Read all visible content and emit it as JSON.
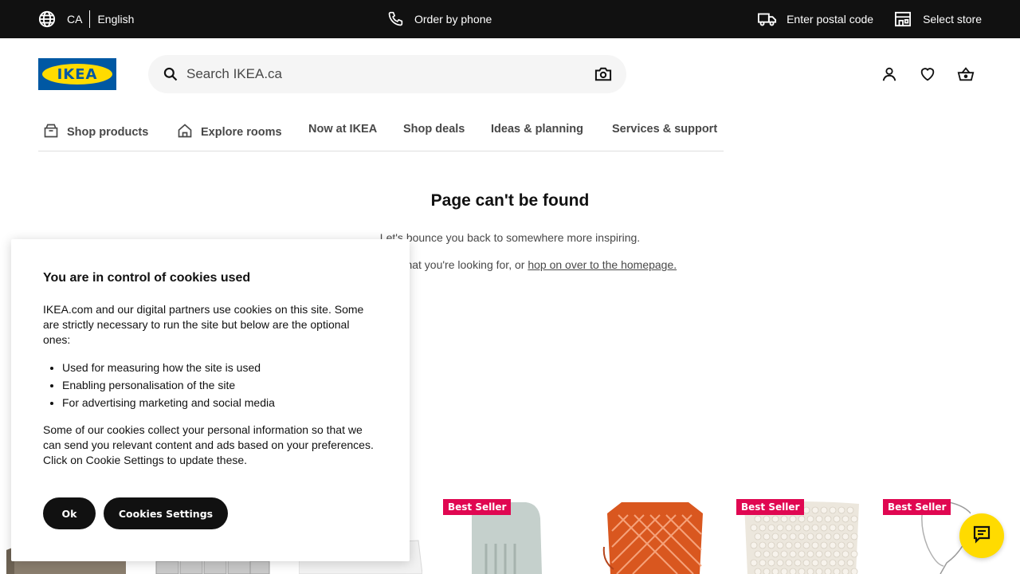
{
  "topbar": {
    "country": "CA",
    "language": "English",
    "order_by_phone": "Order by phone",
    "postal_code": "Enter postal code",
    "select_store": "Select store"
  },
  "header": {
    "logo_text": "IKEA",
    "search_placeholder": "Search IKEA.ca"
  },
  "nav": {
    "items": [
      {
        "label": "Shop products",
        "icon": "box-icon"
      },
      {
        "label": "Explore rooms",
        "icon": "house-icon"
      },
      {
        "label": "Now at IKEA"
      },
      {
        "label": "Shop deals"
      },
      {
        "label": "Ideas & planning"
      },
      {
        "label": "Services & support"
      }
    ]
  },
  "main": {
    "title": "Page can't be found",
    "line1": "Let's bounce you back to somewhere more inspiring.",
    "line2_prefix": "Search for what you're looking for, or ",
    "line2_link": "hop on over to the homepage."
  },
  "products": {
    "badge": "Best Seller"
  },
  "cookie": {
    "title": "You are in control of cookies used",
    "intro": "IKEA.com and our digital partners use cookies on this site. Some are strictly necessary to run the site but below are the optional ones:",
    "items": [
      "Used for measuring how the site is used",
      "Enabling personalisation of the site",
      "For advertising marketing and social media"
    ],
    "outro": "Some of our cookies collect your personal information so that we can send you relevant content and ads based on your preferences. Click on Cookie Settings to update these.",
    "ok_label": "Ok",
    "settings_label": "Cookies Settings"
  },
  "colors": {
    "brand_blue": "#0058a3",
    "brand_yellow": "#ffdb00",
    "badge_red": "#e00751"
  }
}
